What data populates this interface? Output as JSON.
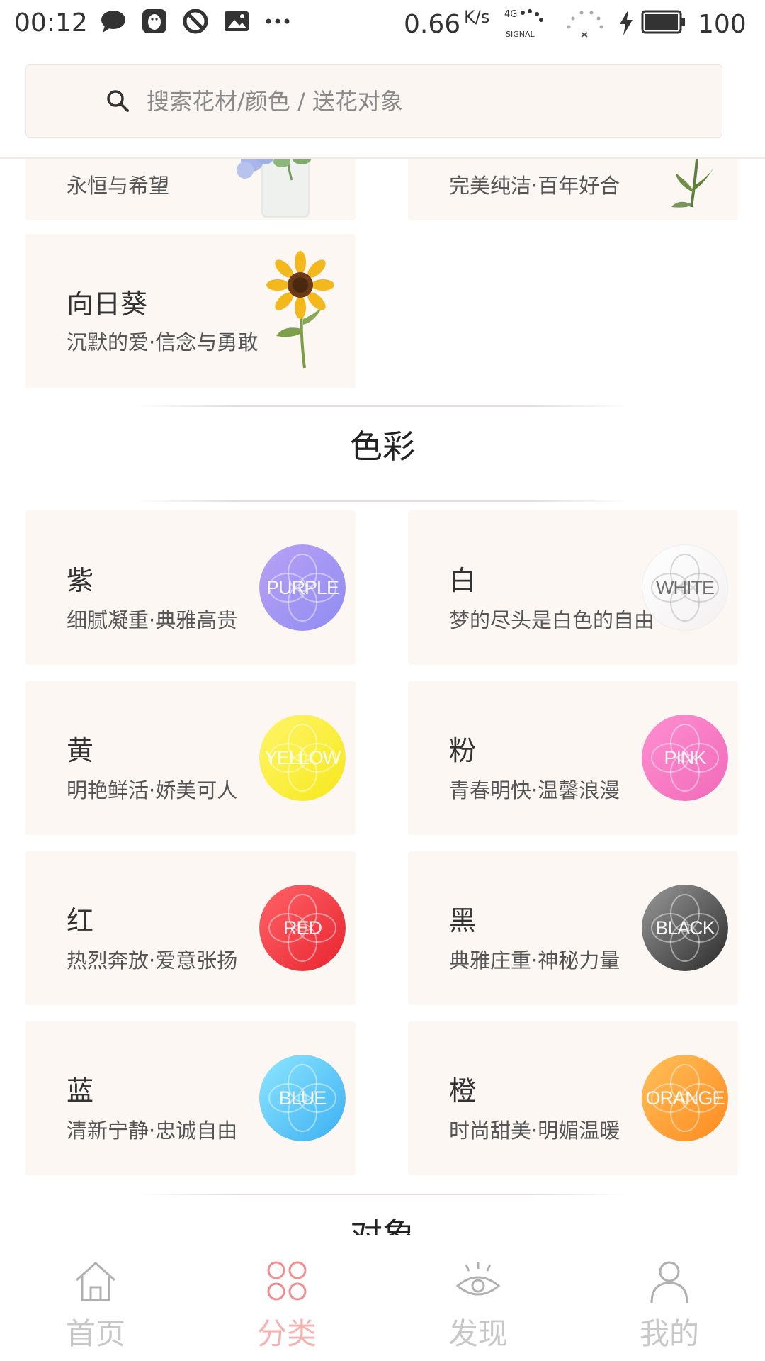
{
  "status_bar": {
    "time": "00:12",
    "network_speed": "0.66",
    "network_speed_unit": "K/s",
    "signal_label": "SIGNAL",
    "signal_type": "4G",
    "battery": "100",
    "icons": [
      "chat-bubble-icon",
      "qq-penguin-icon",
      "no-entry-icon",
      "image-icon",
      "more-dots-icon"
    ]
  },
  "search": {
    "placeholder": "搜索花材/颜色 / 送花对象"
  },
  "flower_cards": [
    {
      "title": "",
      "desc": "永恒与希望",
      "art": "hydrangea-vase-image"
    },
    {
      "title": "",
      "desc": "完美纯洁·百年好合",
      "art": "lily-stem-image"
    },
    {
      "title": "向日葵",
      "desc": "沉默的爱·信念与勇敢",
      "art": "sunflower-image"
    }
  ],
  "colors_section": {
    "title": "色彩",
    "items": [
      {
        "title": "紫",
        "desc": "细腻凝重·典雅高贵",
        "badge": "PURPLE",
        "color_a": "#b9a1f5",
        "color_b": "#8f8cf2"
      },
      {
        "title": "白",
        "desc": "梦的尽头是白色的自由",
        "badge": "WHITE",
        "color_a": "#ffffff",
        "color_b": "#f3f0f0"
      },
      {
        "title": "黄",
        "desc": "明艳鲜活·娇美可人",
        "badge": "YELLOW",
        "color_a": "#fff56a",
        "color_b": "#f6e81c"
      },
      {
        "title": "粉",
        "desc": "青春明快·温馨浪漫",
        "badge": "PINK",
        "color_a": "#ff8fd1",
        "color_b": "#f06ab9"
      },
      {
        "title": "红",
        "desc": "热烈奔放·爱意张扬",
        "badge": "RED",
        "color_a": "#ff6468",
        "color_b": "#e8242f"
      },
      {
        "title": "黑",
        "desc": "典雅庄重·神秘力量",
        "badge": "BLACK",
        "color_a": "#9a9a9a",
        "color_b": "#2a2a2a"
      },
      {
        "title": "蓝",
        "desc": "清新宁静·忠诚自由",
        "badge": "BLUE",
        "color_a": "#8ee6ff",
        "color_b": "#3bb0f2"
      },
      {
        "title": "橙",
        "desc": "时尚甜美·明媚温暖",
        "badge": "ORANGE",
        "color_a": "#ffc05a",
        "color_b": "#ff8a1e"
      }
    ]
  },
  "objects_section": {
    "title": "对象"
  },
  "bottom_nav": {
    "active_color": "#f2b3b3",
    "inactive_color": "#c8c8c8",
    "items": [
      {
        "label": "首页",
        "icon": "home-icon"
      },
      {
        "label": "分类",
        "icon": "category-circles-icon"
      },
      {
        "label": "发现",
        "icon": "eye-icon"
      },
      {
        "label": "我的",
        "icon": "person-icon"
      }
    ]
  }
}
